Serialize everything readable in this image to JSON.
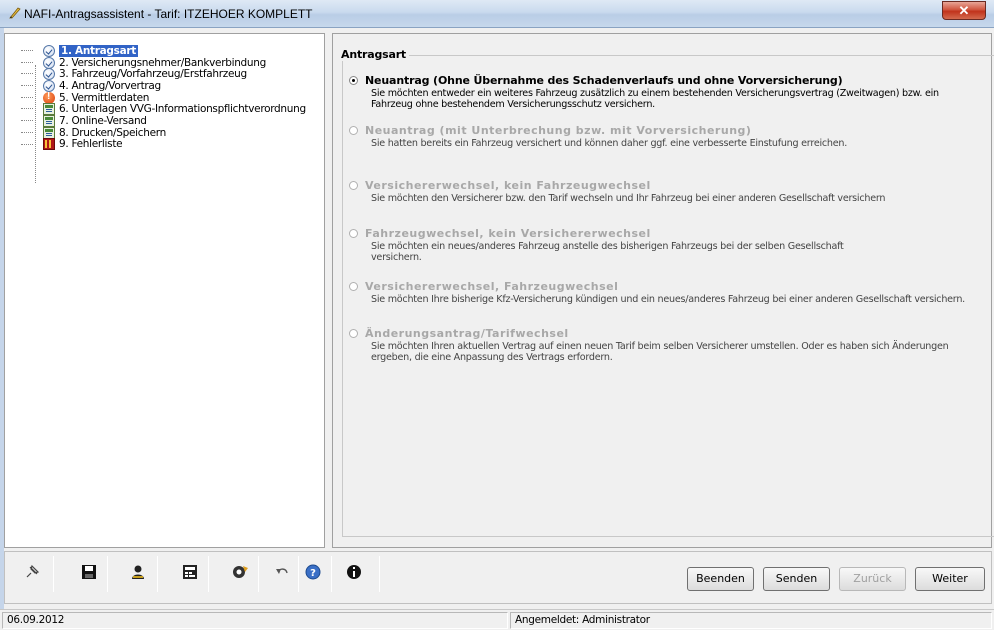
{
  "window": {
    "title": "NAFI-Antragsassistent - Tarif: ITZEHOER KOMPLETT",
    "close_symbol": "✕"
  },
  "tree": {
    "items": [
      {
        "label": "1. Antragsart",
        "icon": "check-icon",
        "selected": true
      },
      {
        "label": "2. Versicherungsnehmer/Bankverbindung",
        "icon": "check-icon"
      },
      {
        "label": "3. Fahrzeug/Vorfahrzeug/Erstfahrzeug",
        "icon": "check-icon"
      },
      {
        "label": "4. Antrag/Vorvertrag",
        "icon": "check-icon"
      },
      {
        "label": "5. Vermittlerdaten",
        "icon": "warning-icon"
      },
      {
        "label": "6. Unterlagen VVG-Informationspflichtverordnung",
        "icon": "document-icon"
      },
      {
        "label": "7. Online-Versand",
        "icon": "document-icon"
      },
      {
        "label": "8. Drucken/Speichern",
        "icon": "document-icon"
      },
      {
        "label": "9. Fehlerliste",
        "icon": "error-list-icon"
      }
    ]
  },
  "content": {
    "group_title": "Antragsart",
    "options": [
      {
        "title": "Neuantrag (Ohne Übernahme des Schadenverlaufs und ohne Vorversicherung)",
        "desc": "Sie möchten entweder ein weiteres Fahrzeug zusätzlich zu einem bestehenden Versicherungsvertrag (Zweitwagen) bzw. ein Fahrzeug ohne bestehendem Versicherungsschutz versichern.",
        "checked": true
      },
      {
        "title": "Neuantrag (mit Unterbrechung bzw. mit Vorversicherung)",
        "desc": "Sie hatten bereits ein Fahrzeug versichert und können daher ggf. eine verbesserte Einstufung erreichen."
      },
      {
        "title": "Versichererwechsel, kein Fahrzeugwechsel",
        "desc": "Sie möchten den Versicherer bzw. den Tarif wechseln und Ihr Fahrzeug bei einer anderen Gesellschaft versichern"
      },
      {
        "title": "Fahrzeugwechsel, kein Versichererwechsel",
        "desc": "Sie möchten ein neues/anderes Fahrzeug anstelle des bisherigen Fahrzeugs bei der selben Gesellschaft versichern."
      },
      {
        "title": "Versichererwechsel, Fahrzeugwechsel",
        "desc": "Sie möchten Ihre bisherige Kfz-Versicherung kündigen und ein neues/anderes Fahrzeug bei einer anderen Gesellschaft versichern."
      },
      {
        "title": "Änderungsantrag/Tarifwechsel",
        "desc": "Sie möchten Ihren aktuellen Vertrag auf einen neuen Tarif beim selben Versicherer umstellen. Oder es haben sich Änderungen ergeben, die eine Anpassung des Vertrags erfordern."
      }
    ]
  },
  "toolbar": {
    "icons": [
      "pin-icon",
      "save-icon",
      "user-icon",
      "calculator-icon",
      "tools-icon",
      "undo-icon",
      "help-icon",
      "info-icon"
    ],
    "buttons": {
      "beenden": "Beenden",
      "senden": "Senden",
      "zurueck": "Zurück",
      "weiter": "Weiter"
    }
  },
  "status": {
    "date": "06.09.2012",
    "user": "Angemeldet: Administrator"
  }
}
